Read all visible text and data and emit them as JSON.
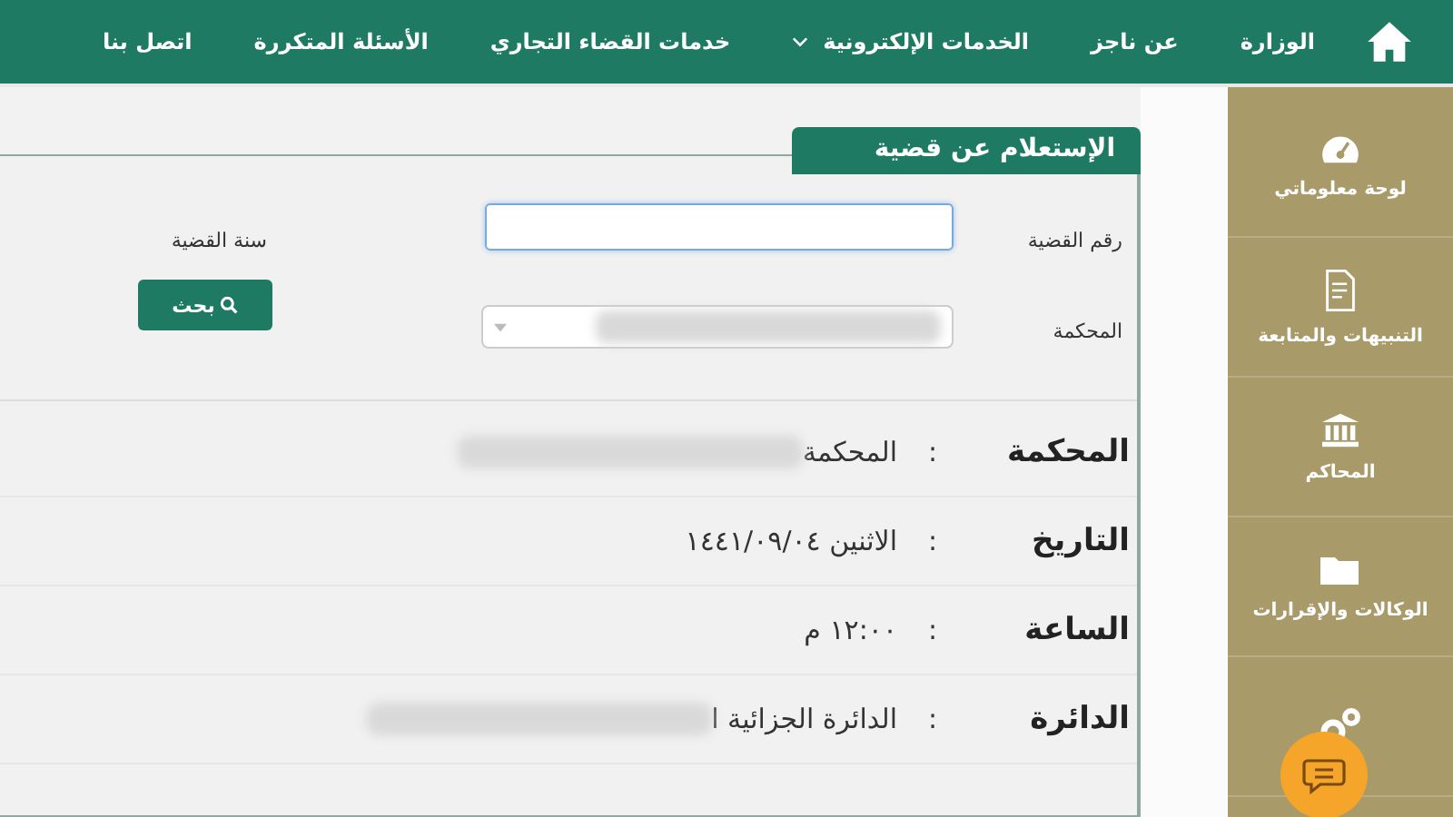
{
  "nav": {
    "items": [
      {
        "label": "الوزارة",
        "dropdown": false
      },
      {
        "label": "عن ناجز",
        "dropdown": false
      },
      {
        "label": "الخدمات الإلكترونية",
        "dropdown": true
      },
      {
        "label": "خدمات القضاء التجاري",
        "dropdown": false
      },
      {
        "label": "الأسئلة المتكررة",
        "dropdown": false
      },
      {
        "label": "اتصل بنا",
        "dropdown": false
      }
    ]
  },
  "sidebar": {
    "items": [
      {
        "label": "لوحة معلوماتي"
      },
      {
        "label": "التنبيهات والمتابعة"
      },
      {
        "label": "المحاكم"
      },
      {
        "label": "الوكالات والإقرارات"
      }
    ]
  },
  "panel": {
    "title": "الإستعلام عن قضية",
    "form": {
      "case_number_label": "رقم القضية",
      "case_year_label": "سنة القضية",
      "court_label": "المحكمة",
      "search_button": "بحث"
    },
    "details": [
      {
        "label": "المحكمة",
        "colon": ":",
        "value": "المحكمة",
        "redacted": true
      },
      {
        "label": "التاريخ",
        "colon": ":",
        "value": "الاثنين ١٤٤١/٠٩/٠٤",
        "redacted": false
      },
      {
        "label": "الساعة",
        "colon": ":",
        "value": "١٢:٠٠ م",
        "redacted": false
      },
      {
        "label": "الدائرة",
        "colon": ":",
        "value": "الدائرة الجزائية ا",
        "redacted": true
      }
    ]
  }
}
